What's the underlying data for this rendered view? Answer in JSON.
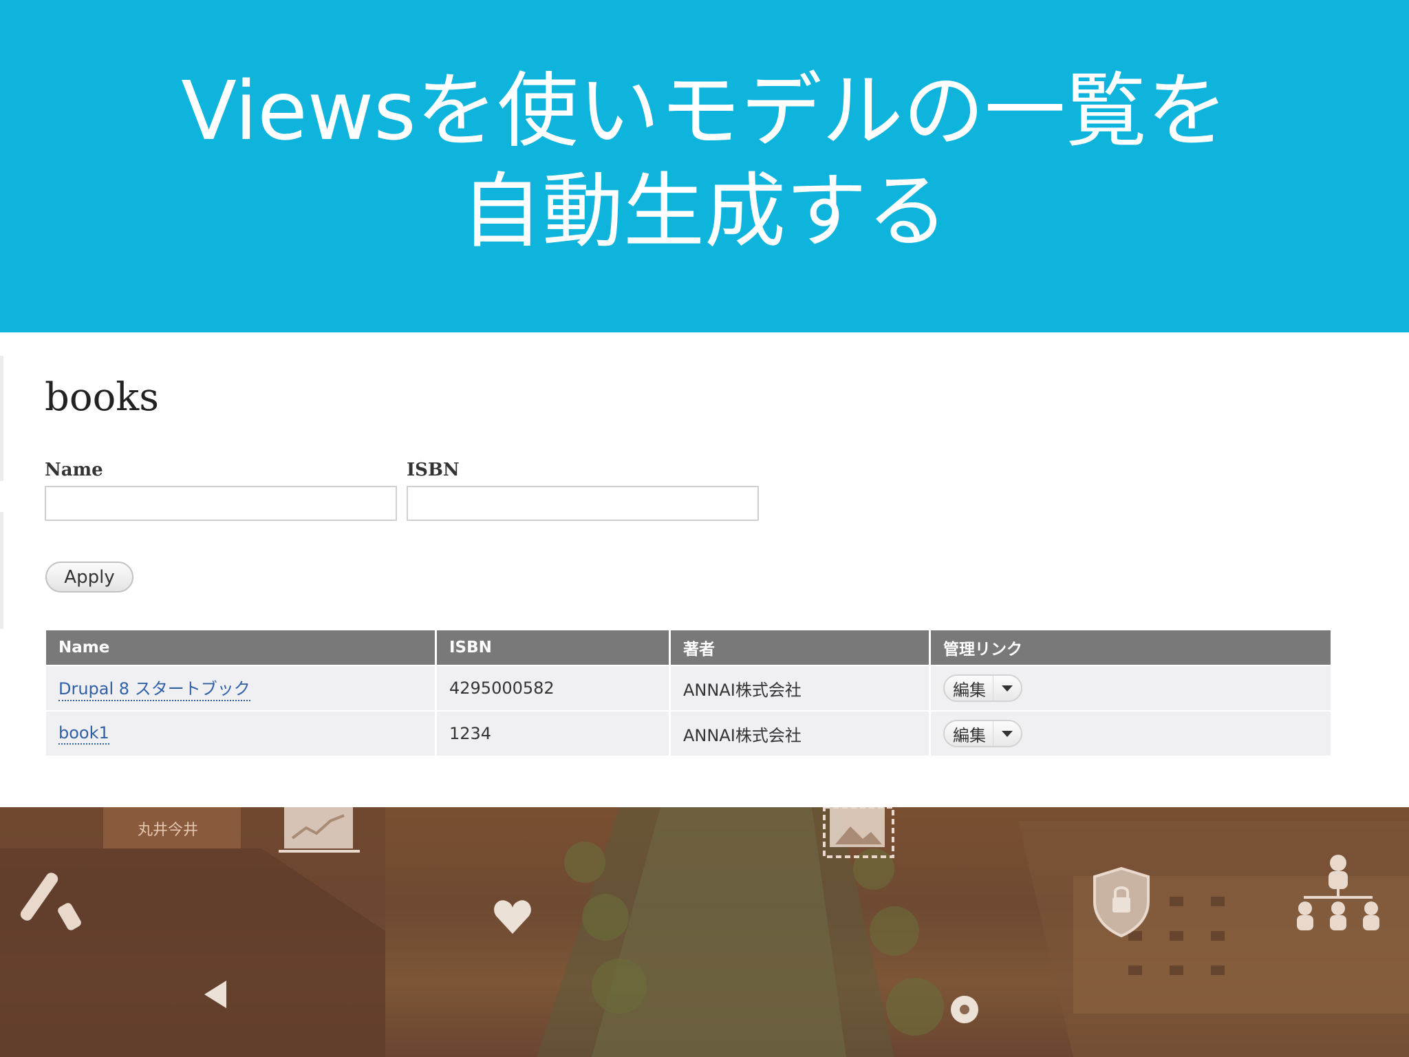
{
  "slide": {
    "title_line1": "Viewsを使いモデルの一覧を",
    "title_line2": "自動生成する",
    "banner_color": "#0fb4dc"
  },
  "view": {
    "heading": "books",
    "filters": {
      "name_label": "Name",
      "name_value": "",
      "isbn_label": "ISBN",
      "isbn_value": "",
      "apply_label": "Apply"
    },
    "table": {
      "columns": [
        "Name",
        "ISBN",
        "著者",
        "管理リンク"
      ],
      "rows": [
        {
          "name": "Drupal 8 スタートブック",
          "isbn": "4295000582",
          "author": "ANNAI株式会社",
          "operation": "編集"
        },
        {
          "name": "book1",
          "isbn": "1234",
          "author": "ANNAI株式会社",
          "operation": "編集"
        }
      ],
      "header_color": "#797979",
      "link_color": "#2f5fa5"
    }
  },
  "photo": {
    "sign_text": "丸井今井",
    "overlay_icons": [
      "paint-roller-icon",
      "chart-icon",
      "heart-icon",
      "play-left-icon",
      "image-icon",
      "location-pin-icon",
      "shield-lock-icon",
      "org-chart-icon"
    ]
  }
}
